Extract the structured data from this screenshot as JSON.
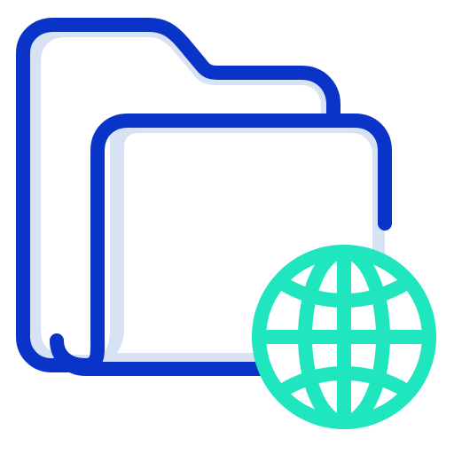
{
  "icon": {
    "name": "network-folder-icon",
    "parts": [
      "folder-back-icon",
      "folder-front-icon",
      "globe-icon"
    ]
  },
  "colors": {
    "outline": "#0a34c8",
    "fill_shadow": "#d8e2f5",
    "background": "#ffffff",
    "globe": "#1fe6bf"
  }
}
